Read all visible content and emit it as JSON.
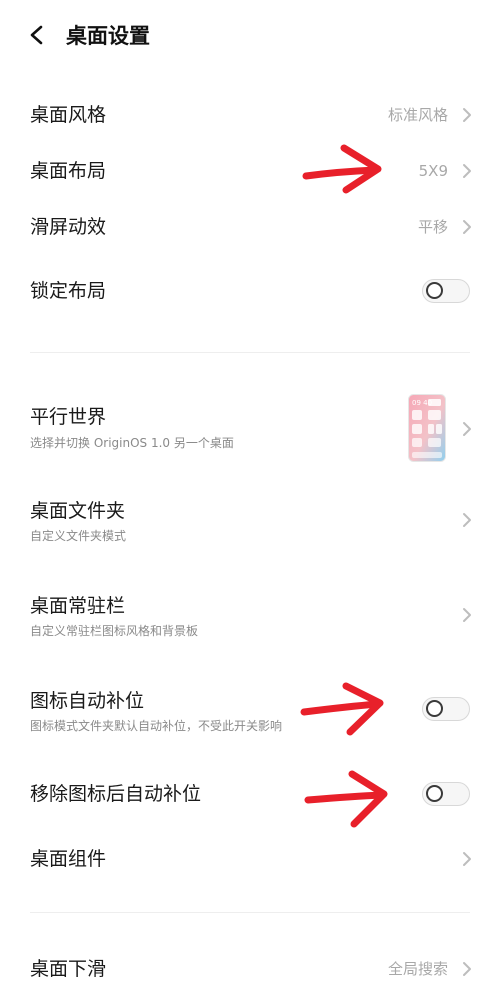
{
  "header": {
    "title": "桌面设置",
    "back_icon": "chevron-left-icon"
  },
  "items": [
    {
      "label": "桌面风格",
      "value": "标准风格"
    },
    {
      "label": "桌面布局",
      "value": "5X9"
    },
    {
      "label": "滑屏动效",
      "value": "平移"
    },
    {
      "label": "锁定布局",
      "toggle": false
    },
    {
      "label": "平行世界",
      "desc": "选择并切换 OriginOS 1.0 另一个桌面",
      "preview": "home-screen-thumbnail"
    },
    {
      "label": "桌面文件夹",
      "desc": "自定义文件夹模式"
    },
    {
      "label": "桌面常驻栏",
      "desc": "自定义常驻栏图标风格和背景板"
    },
    {
      "label": "图标自动补位",
      "desc": "图标模式文件夹默认自动补位，不受此开关影响",
      "toggle": false
    },
    {
      "label": "移除图标后自动补位",
      "toggle": false
    },
    {
      "label": "桌面组件"
    },
    {
      "label": "桌面下滑",
      "value": "全局搜索"
    }
  ],
  "annotations": {
    "arrow_color": "#e8202a",
    "count": 3
  },
  "preview_thumb": {
    "time": "09 40"
  }
}
